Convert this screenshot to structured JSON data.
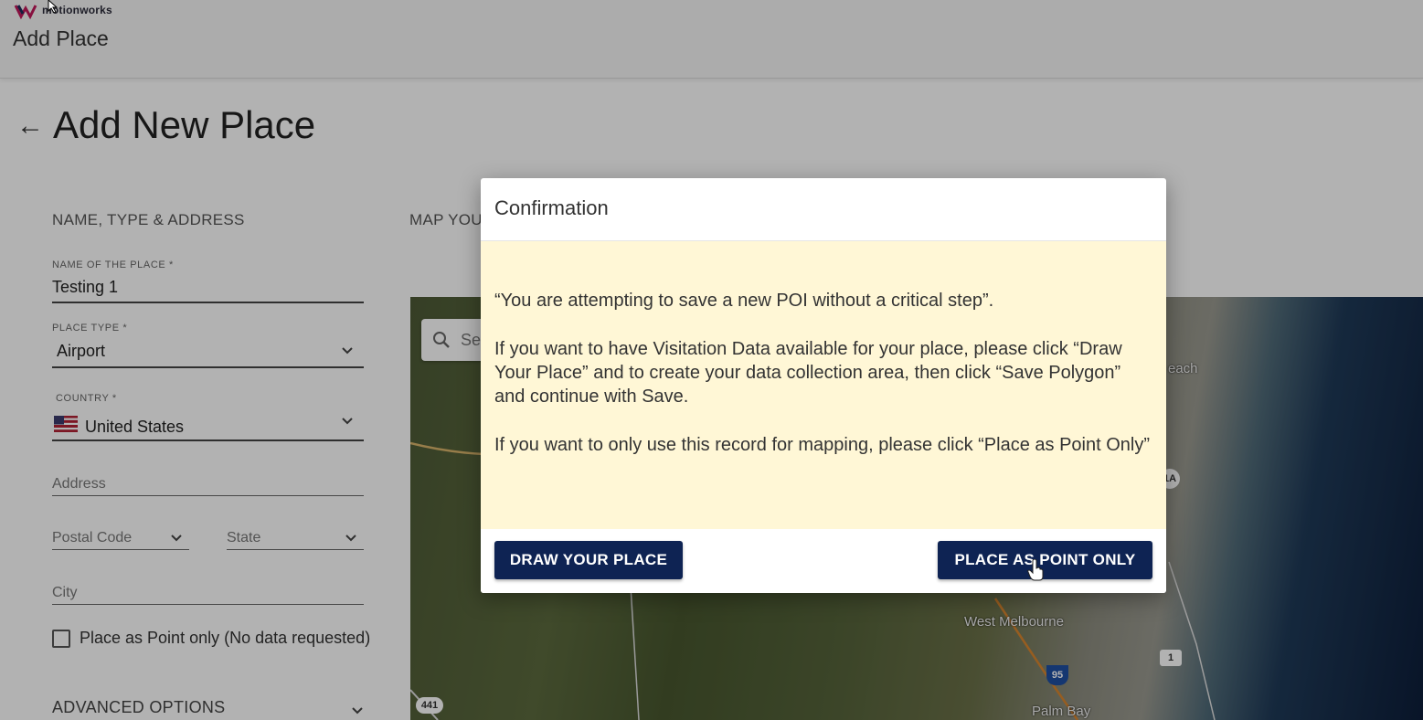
{
  "app": {
    "logo_text": "motionworks",
    "topbar_title": "Add Place"
  },
  "page": {
    "title": "Add New Place"
  },
  "form": {
    "section_label": "NAME, TYPE & ADDRESS",
    "name": {
      "label": "NAME OF THE PLACE *",
      "value": "Testing 1"
    },
    "place_type": {
      "label": "PLACE TYPE *",
      "value": "Airport"
    },
    "country": {
      "label": "COUNTRY *",
      "value": "United States"
    },
    "address_placeholder": "Address",
    "postal_code_placeholder": "Postal Code",
    "state_placeholder": "State",
    "city_placeholder": "City",
    "point_only_label": "Place as Point only (No data requested)",
    "advanced_options": "ADVANCED OPTIONS"
  },
  "map": {
    "section_label": "MAP YOU",
    "search_placeholder": "Se",
    "labels": {
      "beach": "each",
      "west_melbourne": "West Melbourne",
      "palm_bay": "Palm Bay"
    },
    "shields": {
      "us1": "1",
      "i95": "95",
      "sr441": "441",
      "a1a": "1A"
    }
  },
  "modal": {
    "title": "Confirmation",
    "paragraph1": "“You are attempting to save a new POI without a critical step”.",
    "paragraph2": "If you want to have Visitation Data available for your place, please click “Draw Your Place” and to create your data collection area, then click “Save Polygon” and continue with Save.",
    "paragraph3": "If you want to only use this record for mapping, please click “Place as Point Only”",
    "draw_button": "DRAW YOUR PLACE",
    "point_button": "PLACE AS POINT ONLY"
  },
  "colors": {
    "primary_button": "#0e2353",
    "modal_body_bg": "#fff7d6"
  }
}
